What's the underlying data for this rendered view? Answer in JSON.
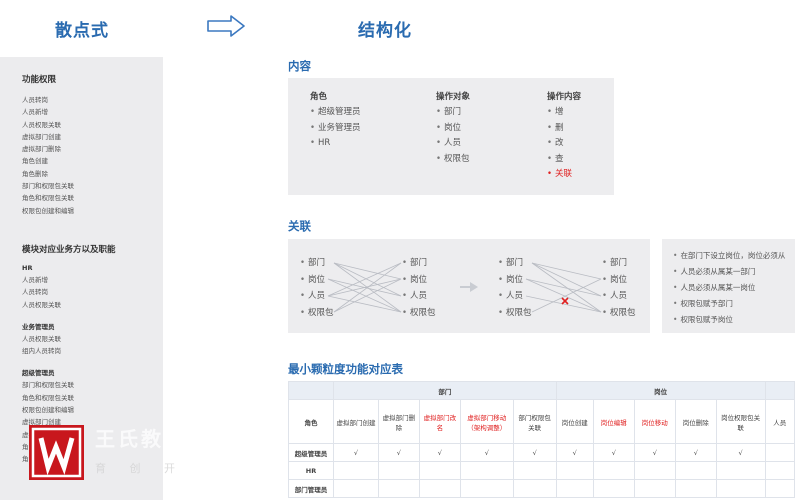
{
  "header": {
    "left_title": "散点式",
    "right_title": "结构化"
  },
  "left_panel": {
    "sections": [
      {
        "title": "功能权限",
        "items": [
          "人员转岗",
          "人员新增",
          "人员权限关联",
          "虚拟部门创建",
          "虚拟部门删除",
          "角色创建",
          "角色删除",
          "部门和权限包关联",
          "角色和权限包关联",
          "权限包创建和编辑"
        ]
      },
      {
        "title": "模块对应业务方以及职能",
        "groups": [
          {
            "name": "HR",
            "items": [
              "人员新增",
              "人员转岗",
              "人员权限关联"
            ]
          },
          {
            "name": "业务管理员",
            "items": [
              "人员权限关联",
              "组内人员转岗"
            ]
          },
          {
            "name": "超级管理员",
            "items": [
              "部门和权限包关联",
              "角色和权限包关联",
              "权限包创建和编辑",
              "虚拟部门创建",
              "虚拟部门删除",
              "角色创建",
              "角色删除"
            ]
          }
        ]
      }
    ]
  },
  "content": {
    "title": "内容",
    "columns": [
      {
        "head": "角色",
        "items": [
          {
            "text": "超级管理员"
          },
          {
            "text": "业务管理员"
          },
          {
            "text": "HR"
          }
        ]
      },
      {
        "head": "操作对象",
        "items": [
          {
            "text": "部门"
          },
          {
            "text": "岗位"
          },
          {
            "text": "人员"
          },
          {
            "text": "权限包"
          }
        ]
      },
      {
        "head": "操作内容",
        "items": [
          {
            "text": "增"
          },
          {
            "text": "删"
          },
          {
            "text": "改"
          },
          {
            "text": "查"
          },
          {
            "text": "关联",
            "highlight": true
          }
        ]
      }
    ]
  },
  "relation": {
    "title": "关联",
    "left_set": [
      "部门",
      "岗位",
      "人员",
      "权限包"
    ],
    "right_set": [
      "部门",
      "岗位",
      "人员",
      "权限包"
    ],
    "rules": [
      "在部门下设立岗位，岗位必须从",
      "人员必须从属某一部门",
      "人员必须从属某一岗位",
      "权限包赋予部门",
      "权限包赋予岗位"
    ]
  },
  "table": {
    "title": "最小颗粒度功能对应表",
    "groups": [
      "部门",
      "岗位"
    ],
    "role_header": "角色",
    "columns": [
      {
        "text": "虚拟部门创建",
        "red": false
      },
      {
        "text": "虚拟部门删除",
        "red": false
      },
      {
        "text": "虚拟部门改名",
        "red": true
      },
      {
        "text": "虚拟部门移动（架构调整）",
        "red": true
      },
      {
        "text": "部门权限包关联",
        "red": false
      },
      {
        "text": "岗位创建",
        "red": false
      },
      {
        "text": "岗位编辑",
        "red": true
      },
      {
        "text": "岗位移动",
        "red": true
      },
      {
        "text": "岗位删除",
        "red": false
      },
      {
        "text": "岗位权限包关联",
        "red": false
      },
      {
        "text": "人员",
        "red": false
      }
    ],
    "rows": [
      {
        "role": "超级管理员",
        "cells": [
          "√",
          "√",
          "√",
          "√",
          "√",
          "√",
          "√",
          "√",
          "√",
          "√",
          ""
        ]
      },
      {
        "role": "HR",
        "cells": [
          "",
          "",
          "",
          "",
          "",
          "",
          "",
          "",
          "",
          "",
          ""
        ]
      },
      {
        "role": "部门管理员",
        "cells": [
          "",
          "",
          "",
          "",
          "",
          "",
          "",
          "",
          "",
          "",
          ""
        ]
      }
    ]
  },
  "watermark": {
    "text": "王氏教",
    "sub": "育 创 开"
  },
  "colors": {
    "accent": "#2a6bb0",
    "highlight": "#e02020",
    "panel": "#ececee",
    "brand": "#c8171d"
  }
}
